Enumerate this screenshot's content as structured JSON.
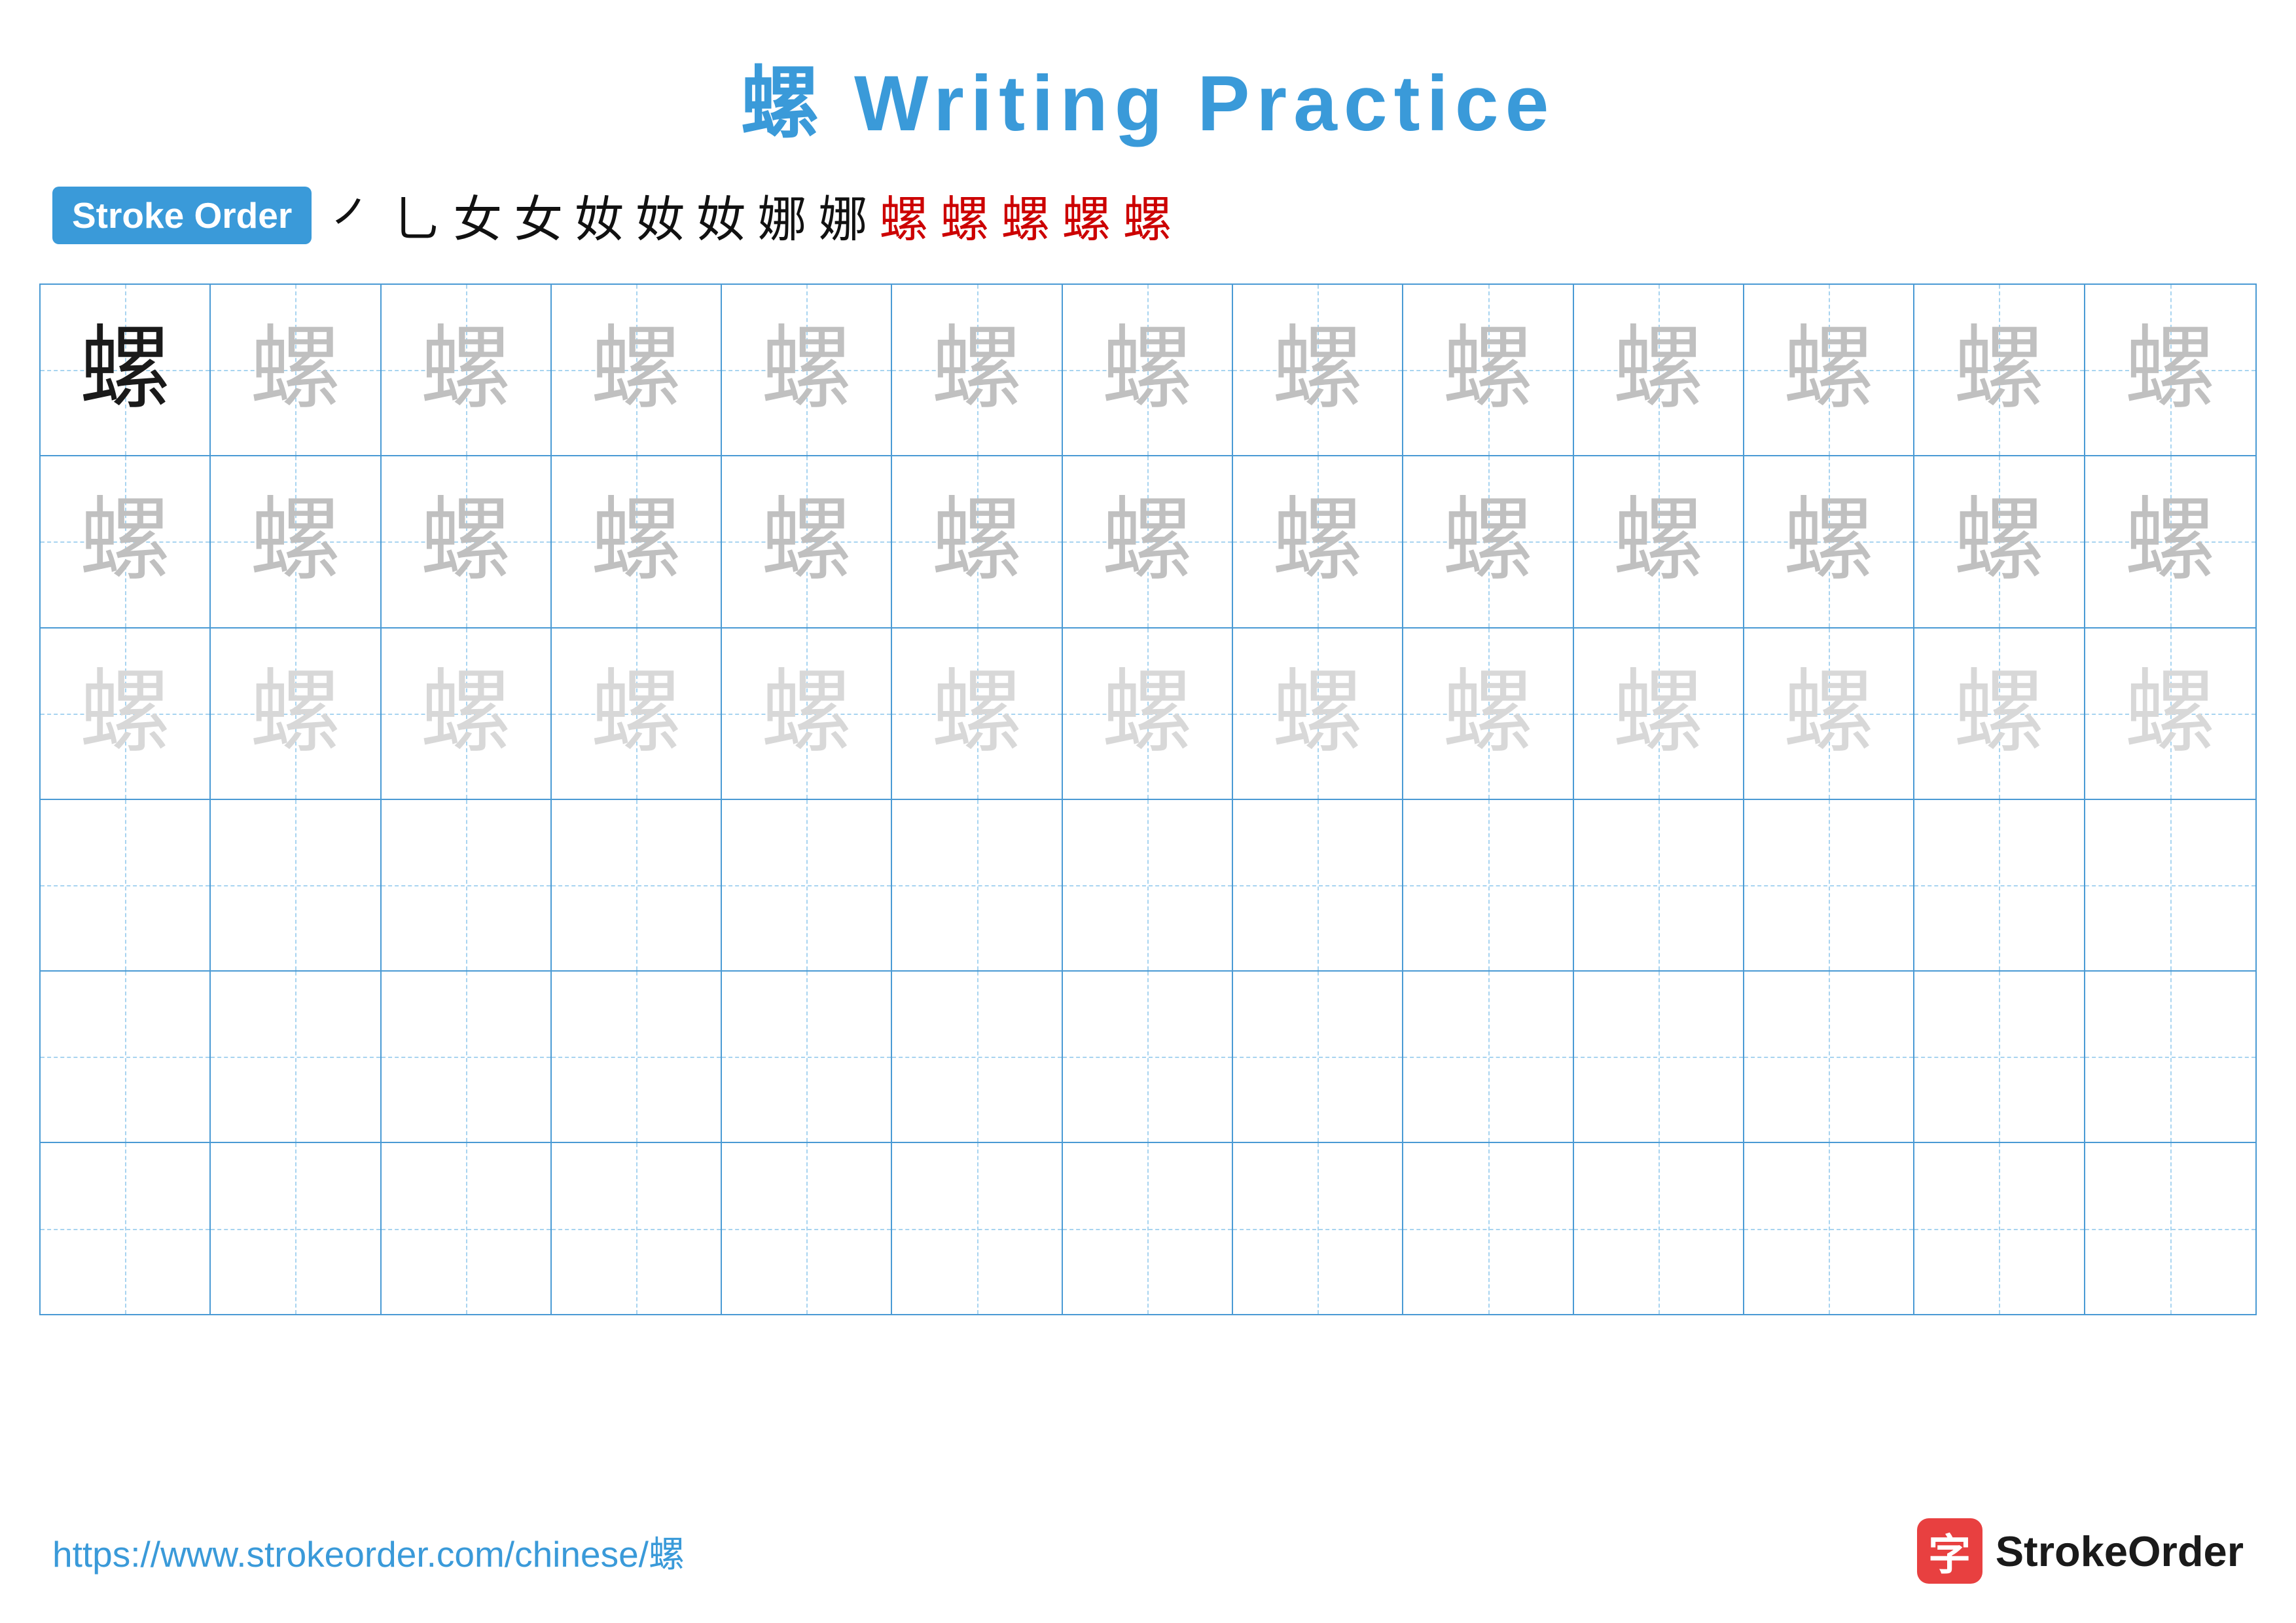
{
  "title": "螺 Writing Practice",
  "stroke_order_label": "Stroke Order",
  "stroke_sequence": [
    "㇒",
    "乚",
    "女",
    "女",
    "奻",
    "奻",
    "奻",
    "娜",
    "娜",
    "螺",
    "螺",
    "螺",
    "螺",
    "螺"
  ],
  "character": "螺",
  "rows": [
    {
      "type": "dark_then_light1",
      "first_dark": true
    },
    {
      "type": "light1"
    },
    {
      "type": "light2"
    },
    {
      "type": "empty"
    },
    {
      "type": "empty"
    },
    {
      "type": "empty"
    }
  ],
  "cols": 13,
  "footer_url": "https://www.strokeorder.com/chinese/螺",
  "footer_logo_text": "StrokeOrder",
  "colors": {
    "accent": "#3a9ad9",
    "dark_char": "#1a1a1a",
    "light1_char": "#c0c0c0",
    "light2_char": "#d8d8d8"
  }
}
